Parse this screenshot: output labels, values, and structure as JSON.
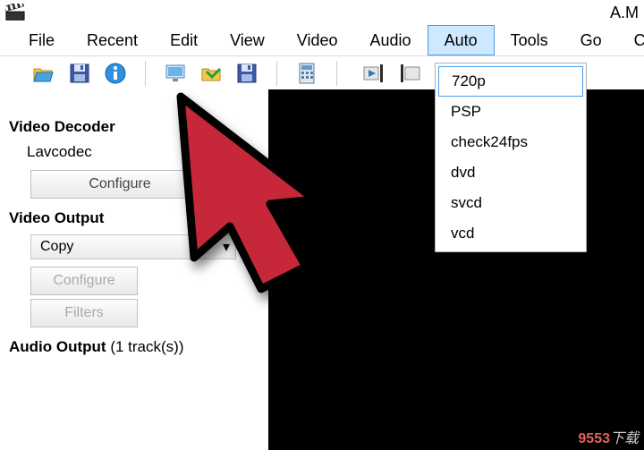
{
  "title_fragment": "A.M",
  "menu": [
    "File",
    "Recent",
    "Edit",
    "View",
    "Video",
    "Audio",
    "Auto",
    "Tools",
    "Go",
    "Cust"
  ],
  "menu_highlight_index": 6,
  "dropdown": [
    "720p",
    "PSP",
    "check24fps",
    "dvd",
    "svcd",
    "vcd"
  ],
  "dropdown_highlight_index": 0,
  "panel": {
    "video_decoder_title": "Video Decoder",
    "video_decoder_value": "Lavcodec",
    "configure_btn": "Configure",
    "video_output_title": "Video Output",
    "video_output_value": "Copy",
    "filters_btn": "Filters",
    "audio_output_title": "Audio Output",
    "audio_output_sub": "(1 track(s))"
  },
  "watermark": {
    "brand": "9553",
    "suffix": "下载"
  },
  "icons": {
    "app": "clapperboard-icon",
    "open": "folder-open-icon",
    "save": "floppy-icon",
    "info": "info-icon",
    "video": "monitor-icon",
    "folder": "folder-green-icon",
    "save2": "floppy-icon",
    "calc": "calculator-icon",
    "playmark": "play-marker-icon"
  }
}
